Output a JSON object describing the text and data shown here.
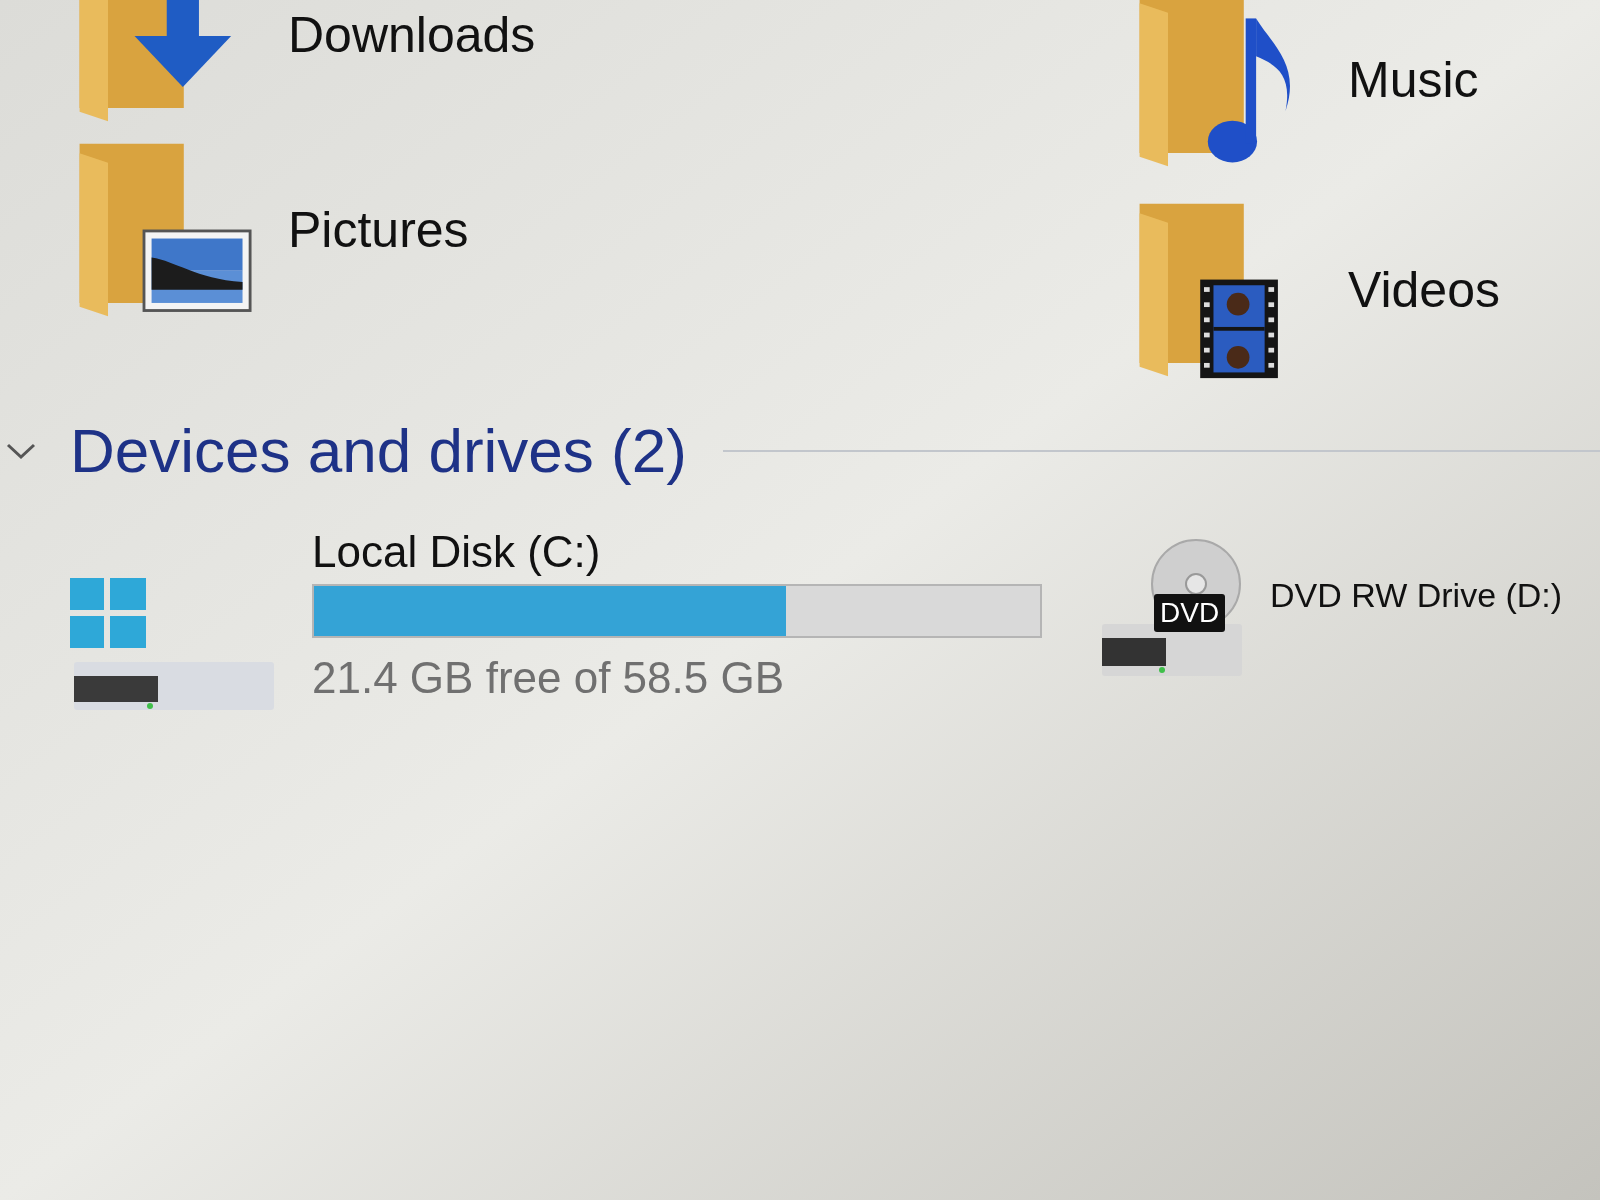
{
  "folders": [
    {
      "kind": "downloads",
      "name": "Downloads"
    },
    {
      "kind": "music",
      "name": "Music"
    },
    {
      "kind": "pictures",
      "name": "Pictures"
    },
    {
      "kind": "videos",
      "name": "Videos"
    }
  ],
  "section": {
    "title": "Devices and drives (2)",
    "expanded": true
  },
  "drives": [
    {
      "kind": "disk",
      "name": "Local Disk (C:)",
      "level": 0.65,
      "free_text": "21.4 GB free of 58.5 GB"
    },
    {
      "kind": "dvd",
      "name": "DVD RW Drive (D:)",
      "badge": "DVD"
    }
  ]
}
